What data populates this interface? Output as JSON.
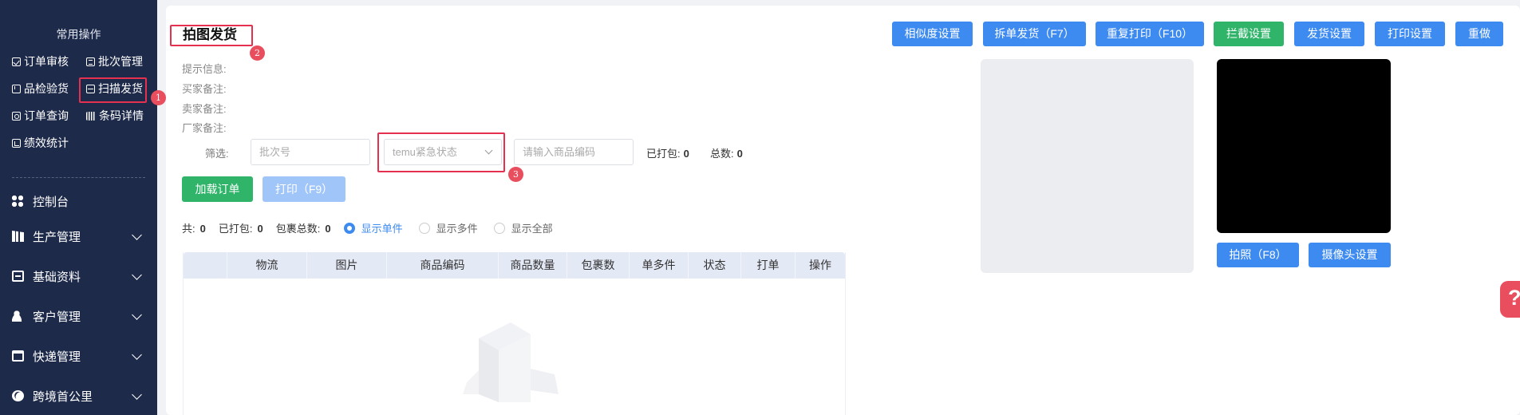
{
  "sidebar": {
    "heading": "常用操作",
    "quick": [
      {
        "label": "订单审核",
        "icon": "check-square-icon"
      },
      {
        "label": "批次管理",
        "icon": "batch-icon"
      },
      {
        "label": "品检验货",
        "icon": "inspect-icon"
      },
      {
        "label": "扫描发货",
        "icon": "scan-icon"
      },
      {
        "label": "订单查询",
        "icon": "search-doc-icon"
      },
      {
        "label": "条码详情",
        "icon": "barcode-icon"
      },
      {
        "label": "绩效统计",
        "icon": "chart-icon"
      }
    ],
    "nav": [
      {
        "label": "控制台",
        "icon": "dashboard-icon"
      },
      {
        "label": "生产管理",
        "icon": "production-icon"
      },
      {
        "label": "基础资料",
        "icon": "data-icon"
      },
      {
        "label": "客户管理",
        "icon": "customer-icon"
      },
      {
        "label": "快递管理",
        "icon": "express-icon"
      },
      {
        "label": "跨境首公里",
        "icon": "globe-icon"
      }
    ]
  },
  "badges": [
    "1",
    "2",
    "3"
  ],
  "page": {
    "title": "拍图发货",
    "info_labels": [
      "提示信息:",
      "买家备注:",
      "卖家备注:",
      "厂家备注:"
    ]
  },
  "toolbar": {
    "buttons": [
      "相似度设置",
      "拆单发货（F7）",
      "重复打印（F10）",
      "拦截设置",
      "发货设置",
      "打印设置",
      "重做"
    ]
  },
  "filter": {
    "label": "筛选:",
    "batch_placeholder": "批次号",
    "status_placeholder": "temu紧急状态",
    "code_placeholder": "请输入商品编码",
    "packed_label": "已打包:",
    "packed_value": "0",
    "total_label": "总数:",
    "total_value": "0"
  },
  "actions": {
    "load": "加载订单",
    "print": "打印（F9）"
  },
  "counts": {
    "all_label": "共:",
    "all_value": "0",
    "packed_label": "已打包:",
    "packed_value": "0",
    "parcels_label": "包裹总数:",
    "parcels_value": "0"
  },
  "radios": [
    {
      "label": "显示单件",
      "checked": true
    },
    {
      "label": "显示多件",
      "checked": false
    },
    {
      "label": "显示全部",
      "checked": false
    }
  ],
  "table": {
    "columns": [
      "",
      "物流",
      "图片",
      "商品编码",
      "商品数量",
      "包裹数",
      "单多件",
      "状态",
      "打单",
      "操作"
    ]
  },
  "camera": {
    "photo": "拍照（F8）",
    "settings": "摄像头设置"
  },
  "colors": {
    "sidebar": "#1e2a4a",
    "primary": "#3d8af0",
    "success": "#2fb46a",
    "highlight": "#e5304f"
  }
}
